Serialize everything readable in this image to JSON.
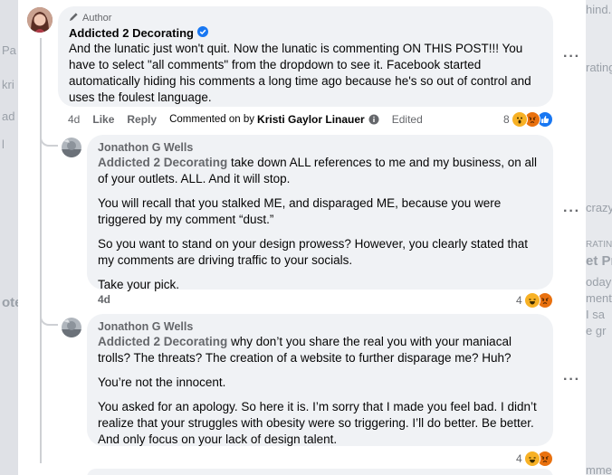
{
  "background": {
    "left_fragments": [
      "Pa",
      "kri",
      "ad",
      "l",
      "ote"
    ],
    "right_fragments": [
      "hind.",
      "rating",
      "crazy",
      "RATING",
      "et Pr",
      "oday",
      "ment",
      "I sa",
      "e gr",
      "mme"
    ]
  },
  "post_comment": {
    "author_badge": "Author",
    "name": "Addicted 2 Decorating",
    "text": "And the lunatic just won't quit. Now the lunatic is commenting ON THIS POST!!! You have to select \"all comments\" from the dropdown to see it. Facebook started automatically hiding his comments a long time ago because he's so out of control and uses the foulest language.",
    "time": "4d",
    "like": "Like",
    "reply": "Reply",
    "commented_on_by": "Commented on by",
    "commenter": "Kristi Gaylor Linauer",
    "edited": "Edited",
    "reaction_count": "8"
  },
  "replies": [
    {
      "name": "Jonathon G Wells",
      "mention": "Addicted 2 Decorating",
      "paragraphs": [
        " take down ALL references to me and my business, on all of your outlets. ALL. And it will stop.",
        "You will recall that you stalked ME, and disparaged ME, because you were triggered by my comment “dust.”",
        "So you want to stand on your design prowess? However, you clearly stated that my comments are driving traffic to your socials.",
        "Take your pick."
      ],
      "time": "4d",
      "reaction_count": "4"
    },
    {
      "name": "Jonathon G Wells",
      "mention": "Addicted 2 Decorating",
      "paragraphs": [
        " why don’t you share the real you with your maniacal trolls? The threats? The creation of a website to further disparage me? Huh?",
        "You’re not the innocent.",
        "You asked for an apology. So here it is. I’m sorry that I made you feel bad. I didn’t realize that your struggles with obesity were so triggering. I’ll do better. Be better. And only focus on your lack of design talent."
      ],
      "reaction_count": "4"
    }
  ],
  "icons": {
    "more": "more-options-icon",
    "verified": "verified-badge-icon",
    "author": "pencil-icon",
    "info": "info-icon"
  },
  "colors": {
    "verified": "#1877f2",
    "angry": "#e9710f",
    "haha": "#f7b125",
    "like": "#1877f2",
    "bubble": "#f0f2f5"
  }
}
